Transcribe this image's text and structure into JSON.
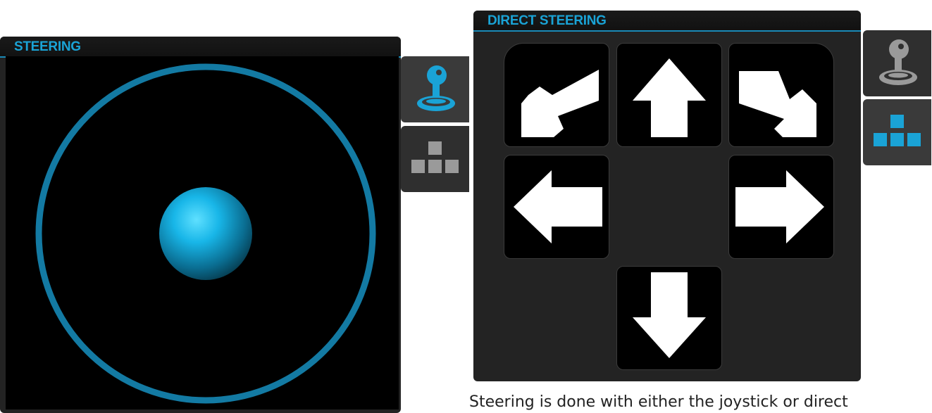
{
  "steering_panel": {
    "title": "STEERING",
    "tabs": [
      {
        "name": "joystick",
        "icon": "joystick-icon",
        "active": true
      },
      {
        "name": "direct",
        "icon": "direction-pad-icon",
        "active": false
      }
    ]
  },
  "direct_panel": {
    "title": "DIRECT STEERING",
    "buttons": [
      {
        "name": "up-left",
        "icon": "arrow-up-left-icon"
      },
      {
        "name": "up",
        "icon": "arrow-up-icon"
      },
      {
        "name": "up-right",
        "icon": "arrow-up-right-icon"
      },
      {
        "name": "left",
        "icon": "arrow-left-icon"
      },
      {
        "name": "right",
        "icon": "arrow-right-icon"
      },
      {
        "name": "down",
        "icon": "arrow-down-icon"
      }
    ],
    "tabs": [
      {
        "name": "joystick",
        "icon": "joystick-icon",
        "active": false
      },
      {
        "name": "direct",
        "icon": "direction-pad-icon",
        "active": true
      }
    ]
  },
  "caption": "Steering is done with either the joystick or direct",
  "colors": {
    "accent": "#1aa3d6",
    "ring": "#137aa3",
    "panel": "#232323",
    "inactive_icon": "#9a9a9a"
  }
}
